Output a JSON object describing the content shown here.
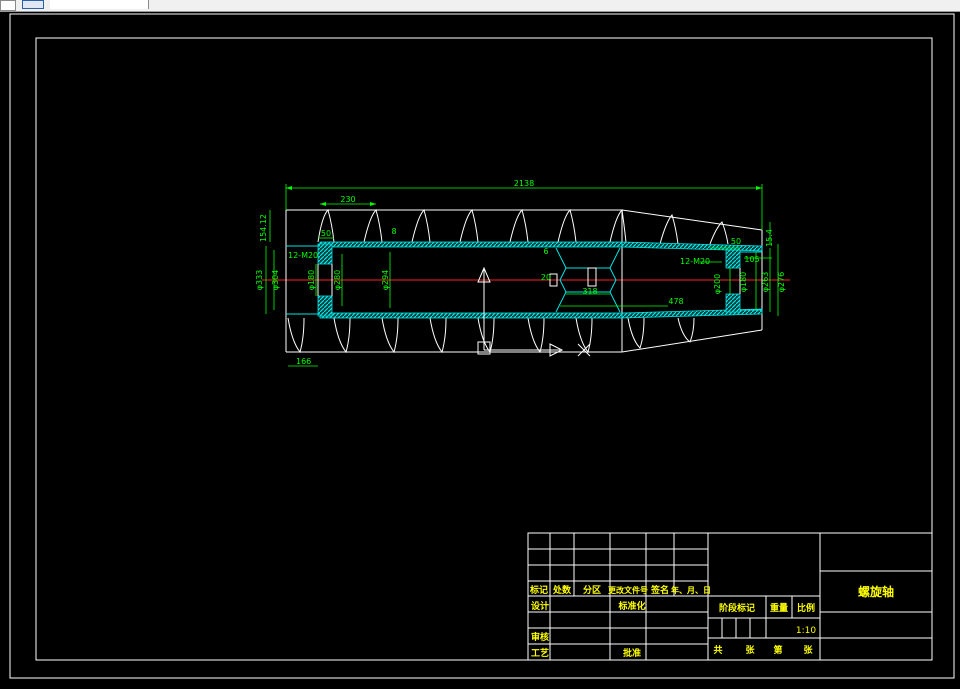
{
  "window": {
    "title": ""
  },
  "colors": {
    "background": "#000000",
    "frame": "#ffffff",
    "dimension": "#00ff00",
    "outline": "#ffffff",
    "section": "#00e5e5",
    "centerline": "#ff2020"
  },
  "drawing": {
    "dims": {
      "overall_length": "2138",
      "pitch": "230",
      "flange_thickness": "154.12",
      "d1": "50",
      "d2": "8",
      "hole_left": "12-M20",
      "hole_right": "12-M20",
      "w_left": "166",
      "d_outer": "φ333",
      "d_flange": "φ304",
      "d_bore": "φ180",
      "d_inner": "φ280",
      "d_tube": "φ294",
      "gap6": "6",
      "s20": "20",
      "mid": "318",
      "len478": "478",
      "r50": "50",
      "r105": "105",
      "dr_180": "φ180",
      "dr_200": "φ200",
      "dr_263": "φ263",
      "dr_276": "φ276",
      "r_flange": "15.4"
    }
  },
  "title_block": {
    "name": "螺旋轴",
    "headers": [
      "标记",
      "处数",
      "分区",
      "更改文件号",
      "签名",
      "年、月、日"
    ],
    "row_design": "设计",
    "row_standard": "标准化",
    "row_review": "审核",
    "row_process": "工艺",
    "row_approve": "批准",
    "stage_label": "阶段标记",
    "weight_label": "重量",
    "scale_label": "比例",
    "scale_value": "1:10",
    "sheets_total": "共",
    "sheet_unit1": "张",
    "sheet_no": "第",
    "sheet_unit2": "张"
  }
}
